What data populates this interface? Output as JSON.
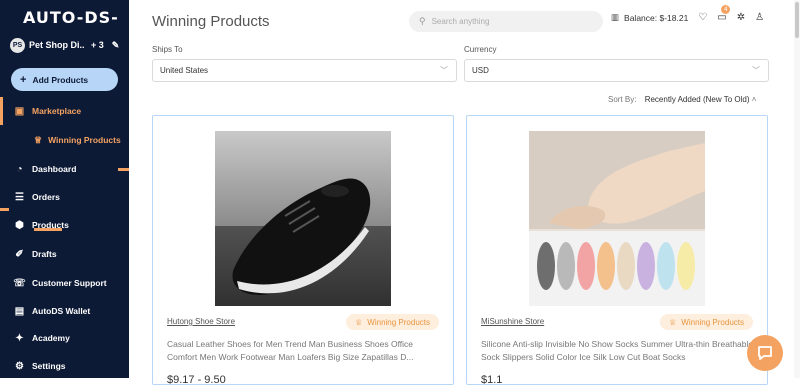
{
  "app": {
    "logo": "AUTO-DS-"
  },
  "sidebar": {
    "store": {
      "initials": "PS",
      "name": "Pet Shop Di...",
      "more": "+ 3"
    },
    "add_products_label": "Add Products",
    "items": [
      {
        "label": "Marketplace",
        "icon": "store-icon"
      },
      {
        "label": "Winning Products",
        "icon": "trophy-icon"
      },
      {
        "label": "Dashboard",
        "icon": "dashboard-icon"
      },
      {
        "label": "Orders",
        "icon": "orders-icon"
      },
      {
        "label": "Products",
        "icon": "box-icon"
      },
      {
        "label": "Drafts",
        "icon": "drafts-icon"
      },
      {
        "label": "Customer Support",
        "icon": "support-icon"
      },
      {
        "label": "AutoDS Wallet",
        "icon": "wallet-icon"
      },
      {
        "label": "Academy",
        "icon": "academy-icon"
      },
      {
        "label": "Settings",
        "icon": "gear-icon"
      }
    ],
    "accent_color": "#f4a261",
    "background": "#0d1a36"
  },
  "header": {
    "title": "Winning Products",
    "search_placeholder": "Search anything",
    "balance": "Balance: $-18.21",
    "notification_count": "4"
  },
  "filters": {
    "ships_to_label": "Ships To",
    "ships_to_value": "United States",
    "currency_label": "Currency",
    "currency_value": "USD",
    "sort_label": "Sort By:",
    "sort_value": "Recently Added (New To Old)"
  },
  "products": [
    {
      "store": "Hutong Shoe Store",
      "tag": "Winning Products",
      "title": "Casual Leather Shoes for Men Trend Man Business Shoes Office Comfort Men Work Footwear Man Loafers Big Size Zapatillas D...",
      "price": "$9.17 - 9.50"
    },
    {
      "store": "MiSunshine Store",
      "tag": "Winning Products",
      "title": "Silicone Anti-slip Invisible No Show Socks Summer Ultra-thin Breathable Sock Slippers Solid Color Ice Silk Low Cut Boat Socks",
      "price": "$1.1"
    }
  ]
}
